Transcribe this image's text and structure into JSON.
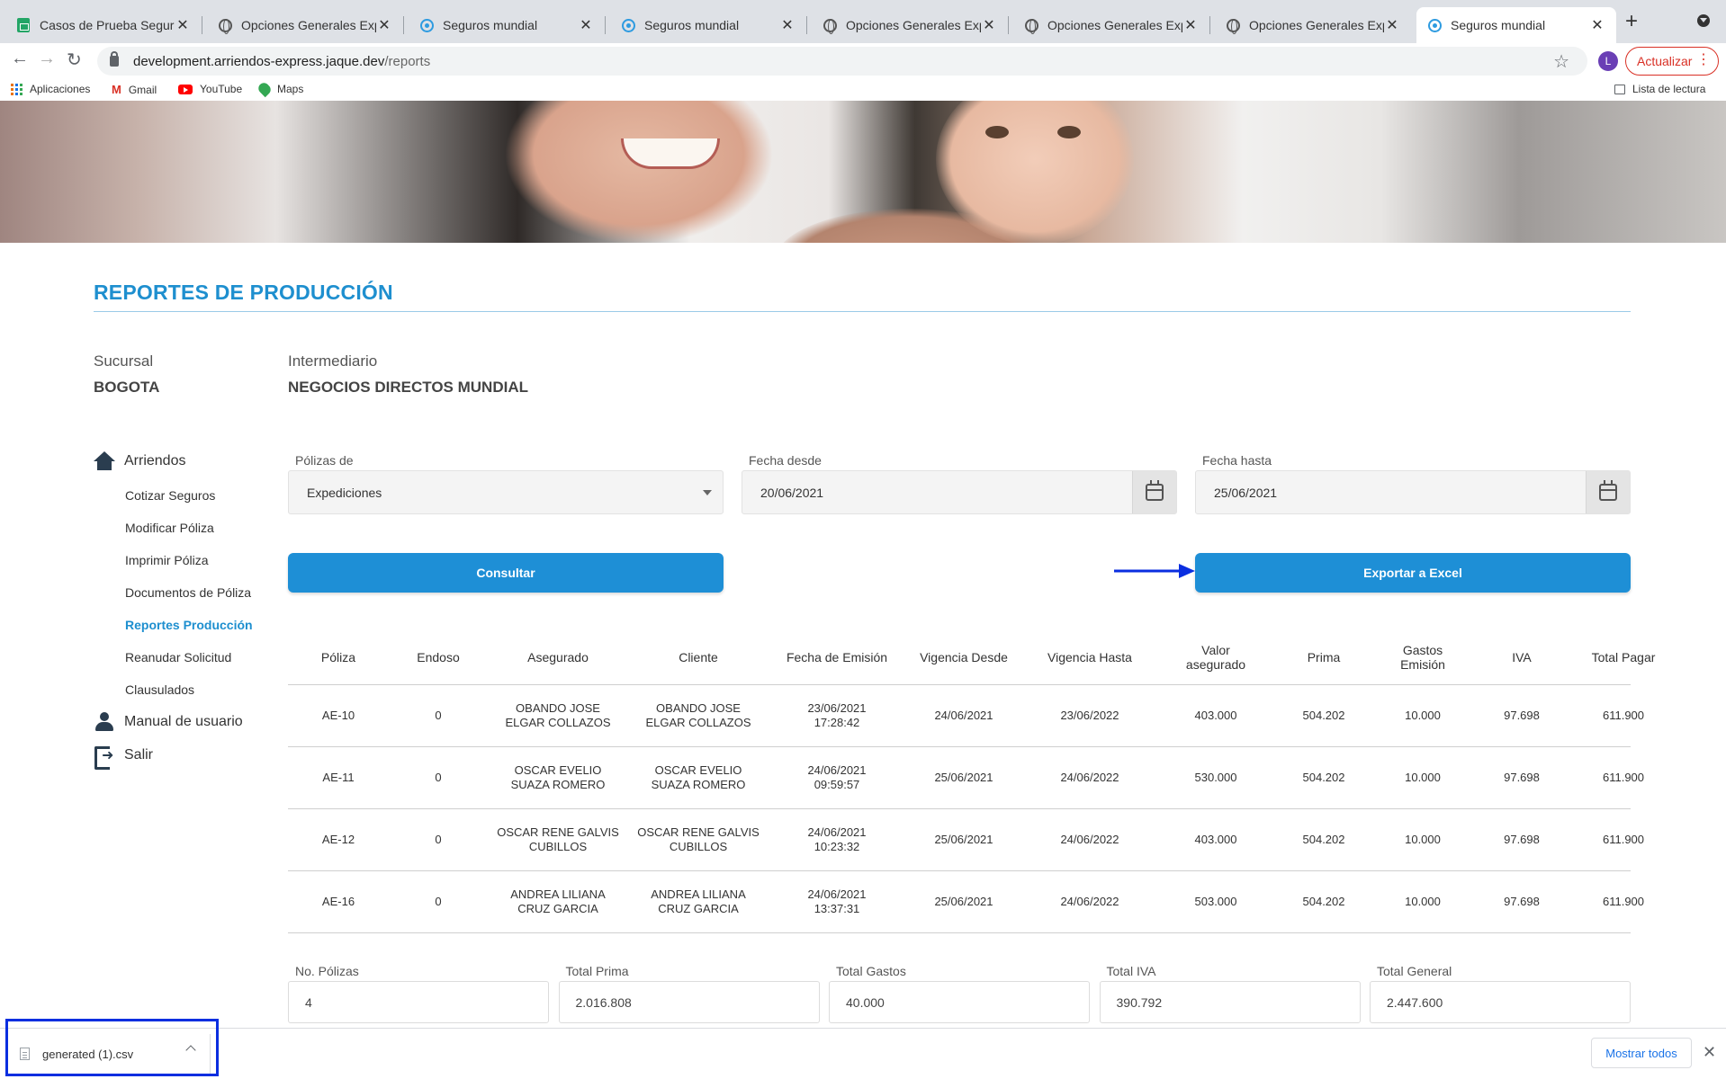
{
  "browser": {
    "tabs": [
      {
        "title": "Casos de Prueba Seguros M",
        "icon": "sheets-icon"
      },
      {
        "title": "Opciones Generales Expedi",
        "icon": "globe-icon"
      },
      {
        "title": "Seguros mundial",
        "icon": "mundial-icon"
      },
      {
        "title": "Seguros mundial",
        "icon": "mundial-icon"
      },
      {
        "title": "Opciones Generales Expedi",
        "icon": "globe-icon"
      },
      {
        "title": "Opciones Generales Expedi",
        "icon": "globe-icon"
      },
      {
        "title": "Opciones Generales Expedi",
        "icon": "globe-icon"
      },
      {
        "title": "Seguros mundial",
        "icon": "mundial-icon",
        "active": true
      }
    ],
    "url_host": "development.arriendos-express.jaque.dev",
    "url_path": "/reports",
    "profile_initial": "L",
    "update_label": "Actualizar",
    "bookmarks": [
      "Aplicaciones",
      "Gmail",
      "YouTube",
      "Maps"
    ],
    "reading_list": "Lista de lectura"
  },
  "page": {
    "title": "REPORTES DE PRODUCCIÓN",
    "sucursal_label": "Sucursal",
    "sucursal_value": "BOGOTA",
    "intermediario_label": "Intermediario",
    "intermediario_value": "NEGOCIOS DIRECTOS MUNDIAL"
  },
  "sidebar": {
    "arriendos": "Arriendos",
    "items": [
      "Cotizar Seguros",
      "Modificar Póliza",
      "Imprimir Póliza",
      "Documentos de Póliza",
      "Reportes Producción",
      "Reanudar Solicitud",
      "Clausulados"
    ],
    "active_item": "Reportes Producción",
    "manual": "Manual de usuario",
    "salir": "Salir"
  },
  "form": {
    "polizas_label": "Pólizas de",
    "polizas_value": "Expediciones",
    "desde_label": "Fecha desde",
    "desde_value": "20/06/2021",
    "hasta_label": "Fecha hasta",
    "hasta_value": "25/06/2021",
    "consultar": "Consultar",
    "exportar": "Exportar a Excel"
  },
  "table": {
    "headers": [
      "Póliza",
      "Endoso",
      "Asegurado",
      "Cliente",
      "Fecha de Emisión",
      "Vigencia Desde",
      "Vigencia Hasta",
      "Valor\nasegurado",
      "Prima",
      "Gastos\nEmisión",
      "IVA",
      "Total Pagar"
    ],
    "rows": [
      [
        "AE-10",
        "0",
        "OBANDO JOSE\nELGAR COLLAZOS",
        "OBANDO JOSE\nELGAR COLLAZOS",
        "23/06/2021\n17:28:42",
        "24/06/2021",
        "23/06/2022",
        "403.000",
        "504.202",
        "10.000",
        "97.698",
        "611.900"
      ],
      [
        "AE-11",
        "0",
        "OSCAR EVELIO\nSUAZA ROMERO",
        "OSCAR EVELIO\nSUAZA ROMERO",
        "24/06/2021\n09:59:57",
        "25/06/2021",
        "24/06/2022",
        "530.000",
        "504.202",
        "10.000",
        "97.698",
        "611.900"
      ],
      [
        "AE-12",
        "0",
        "OSCAR RENE GALVIS\nCUBILLOS",
        "OSCAR RENE GALVIS\nCUBILLOS",
        "24/06/2021\n10:23:32",
        "25/06/2021",
        "24/06/2022",
        "403.000",
        "504.202",
        "10.000",
        "97.698",
        "611.900"
      ],
      [
        "AE-16",
        "0",
        "ANDREA LILIANA\nCRUZ GARCIA",
        "ANDREA LILIANA\nCRUZ GARCIA",
        "24/06/2021\n13:37:31",
        "25/06/2021",
        "24/06/2022",
        "503.000",
        "504.202",
        "10.000",
        "97.698",
        "611.900"
      ]
    ]
  },
  "totals": [
    {
      "label": "No. Pólizas",
      "value": "4"
    },
    {
      "label": "Total Prima",
      "value": "2.016.808"
    },
    {
      "label": "Total Gastos",
      "value": "40.000"
    },
    {
      "label": "Total IVA",
      "value": "390.792"
    },
    {
      "label": "Total General",
      "value": "2.447.600"
    }
  ],
  "downloads": {
    "file": "generated (1).csv",
    "show_all": "Mostrar todos"
  },
  "colors": {
    "accent": "#1e8fcf",
    "button": "#1e8fd6",
    "highlight": "#0a2ee0"
  }
}
